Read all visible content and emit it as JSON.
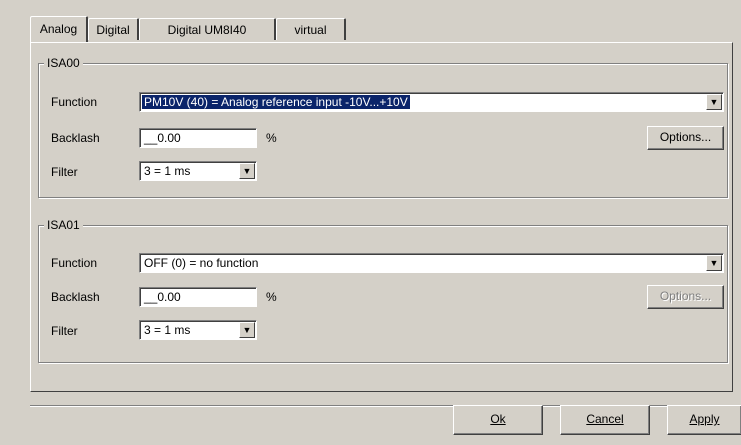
{
  "tabs": [
    {
      "label": "Analog",
      "active": true
    },
    {
      "label": "Digital",
      "active": false
    },
    {
      "label": "Digital UM8I40",
      "active": false
    },
    {
      "label": "virtual",
      "active": false
    }
  ],
  "isa00": {
    "title": "ISA00",
    "function_label": "Function",
    "function_value": "PM10V (40) = Analog reference input -10V...+10V",
    "backlash_label": "Backlash",
    "backlash_value": "__0.00",
    "backlash_unit": "%",
    "filter_label": "Filter",
    "filter_value": "3 = 1 ms",
    "options_label": "Options...",
    "options_enabled": true
  },
  "isa01": {
    "title": "ISA01",
    "function_label": "Function",
    "function_value": "OFF (0) = no function",
    "backlash_label": "Backlash",
    "backlash_value": "__0.00",
    "backlash_unit": "%",
    "filter_label": "Filter",
    "filter_value": "3 = 1 ms",
    "options_label": "Options...",
    "options_enabled": false
  },
  "buttons": {
    "ok": "Ok",
    "cancel": "Cancel",
    "apply": "Apply"
  },
  "icons": {
    "dropdown": "chevron-down-icon"
  }
}
